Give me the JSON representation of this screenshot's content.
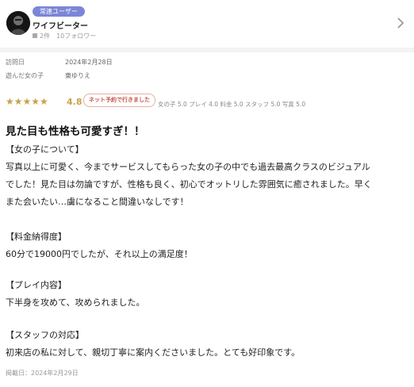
{
  "header": {
    "badge": "常連ユーザー",
    "username": "ワイフビーター",
    "stats": "2件　10フォロワー"
  },
  "meta": {
    "visit_label": "訪問日",
    "visit_value": "2024年2月28日",
    "girl_label": "遊んだ女の子",
    "girl_value": "東ゆりえ"
  },
  "rating": {
    "stars": "★★★★★",
    "score": "4.8",
    "net_badge": "ネット予約で行きました",
    "sub_scores": "女の子 5.0 プレイ 4.0 料金 5.0 スタッフ 5.0 写真 5.0",
    "value": 4.8
  },
  "review": {
    "title": "見た目も性格も可愛すぎ！！",
    "lines": [
      "【女の子について】",
      "写真以上に可愛く、今までサービスしてもらった女の子の中でも過去最高クラスのビジュアル",
      "でした！見た目は勿論ですが、性格も良く、初心でオットリした雰囲気に癒されました。早く",
      "また会いたい…虜になること間違いなしです！",
      "",
      "【料金納得度】",
      "60分で19000円でしたが、それ以上の満足度！",
      "",
      "【プレイ内容】",
      "下半身を攻めて、攻められました。",
      "",
      "【スタッフの対応】",
      "初来店の私に対して、親切丁寧に案内くださいました。とても好印象です。"
    ],
    "posted": "掲載日：2024年2月29日"
  }
}
